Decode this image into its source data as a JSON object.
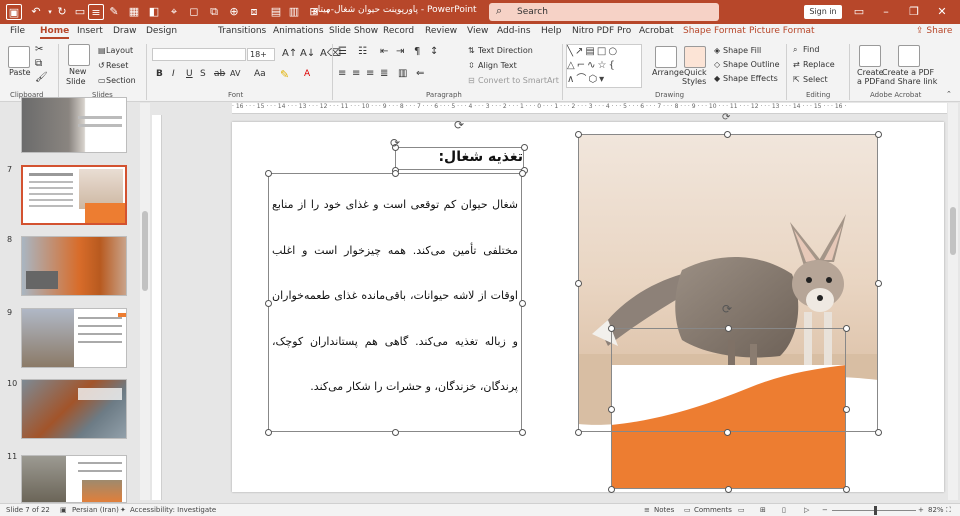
{
  "app": {
    "doc_title": "پاورپوینت حیوان شغال-میتاو - PowerPoint",
    "search_label": "Search",
    "signin_label": "Sign in"
  },
  "window_controls": [
    "–",
    "❐",
    "✕"
  ],
  "menu_tabs": [
    {
      "label": "File"
    },
    {
      "label": "Home"
    },
    {
      "label": "Insert"
    },
    {
      "label": "Draw"
    },
    {
      "label": "Design"
    },
    {
      "label": "Transitions"
    },
    {
      "label": "Animations"
    },
    {
      "label": "Slide Show"
    },
    {
      "label": "Record"
    },
    {
      "label": "Review"
    },
    {
      "label": "View"
    },
    {
      "label": "Add-ins"
    },
    {
      "label": "Help"
    },
    {
      "label": "Nitro PDF Pro"
    },
    {
      "label": "Acrobat"
    },
    {
      "label": "Shape Format"
    },
    {
      "label": "Picture Format"
    }
  ],
  "share_label": "Share",
  "ribbon": {
    "clipboard": {
      "paste": "Paste",
      "group": "Clipboard"
    },
    "slides": {
      "new_slide": "New",
      "new_slide2": "Slide",
      "layout": "Layout",
      "reset": "Reset",
      "section": "Section",
      "group": "Slides"
    },
    "font": {
      "font_size": "18+",
      "bold": "B",
      "italic": "I",
      "underline": "U",
      "strike": "S",
      "shadow": "ab",
      "spacing": "AV",
      "case": "Aa",
      "group": "Font"
    },
    "paragraph": {
      "text_direction": "Text Direction",
      "align_text": "Align Text",
      "convert_smartart": "Convert to SmartArt",
      "group": "Paragraph"
    },
    "drawing": {
      "arrange": "Arrange",
      "quick_styles": "Quick",
      "quick_styles2": "Styles",
      "shape_fill": "Shape Fill",
      "shape_outline": "Shape Outline",
      "shape_effects": "Shape Effects",
      "group": "Drawing"
    },
    "editing": {
      "find": "Find",
      "replace": "Replace",
      "select": "Select",
      "group": "Editing"
    },
    "acrobat": {
      "create_pdf": "Create",
      "create_pdf2": "a PDF",
      "create_share": "Create a PDF",
      "create_share2": "and Share link",
      "group": "Adobe Acrobat"
    }
  },
  "slides_panel": [
    {
      "num": "",
      "selected": false
    },
    {
      "num": "7",
      "selected": true
    },
    {
      "num": "8",
      "selected": false
    },
    {
      "num": "9",
      "selected": false
    },
    {
      "num": "10",
      "selected": false
    },
    {
      "num": "11",
      "selected": false
    }
  ],
  "ruler_ticks": "· 16 · · · 15 · · · 14 · · · 13 · · · 12 · · · 11 · · · 10 · · · 9 · · · 8 · · · 7 · · · 6 · · · 5 · · · 4 · · · 3 · · · 2 · · · 1 · · · 0 · · · 1 · · · 2 · · · 3 · · · 4 · · · 5 · · · 6 · · · 7 · · · 8 · · · 9 · · · 10 · · · 11 · · · 12 · · · 13 · · · 14 · · · 15 · · · 16 ·",
  "slide": {
    "title": "تغذیه شغال:",
    "body": "شغال حیوان کم توقعی است و غذای خود را از منابع مختلفی تأمین می‌کند. همه چیزخوار است و اغلب اوقات از لاشه حیوانات، باقی‌مانده غذای طعمه‌خواران و زباله تغذیه می‌کند. گاهی هم پستانداران کوچک، پرندگان، خزندگان، و حشرات را شکار می‌کند.",
    "accent_color": "#ED7D31"
  },
  "status": {
    "slide_of": "Slide 7 of 22",
    "language": "Persian (Iran)",
    "accessibility": "Accessibility: Investigate",
    "notes": "Notes",
    "comments": "Comments",
    "zoom": "82%"
  }
}
